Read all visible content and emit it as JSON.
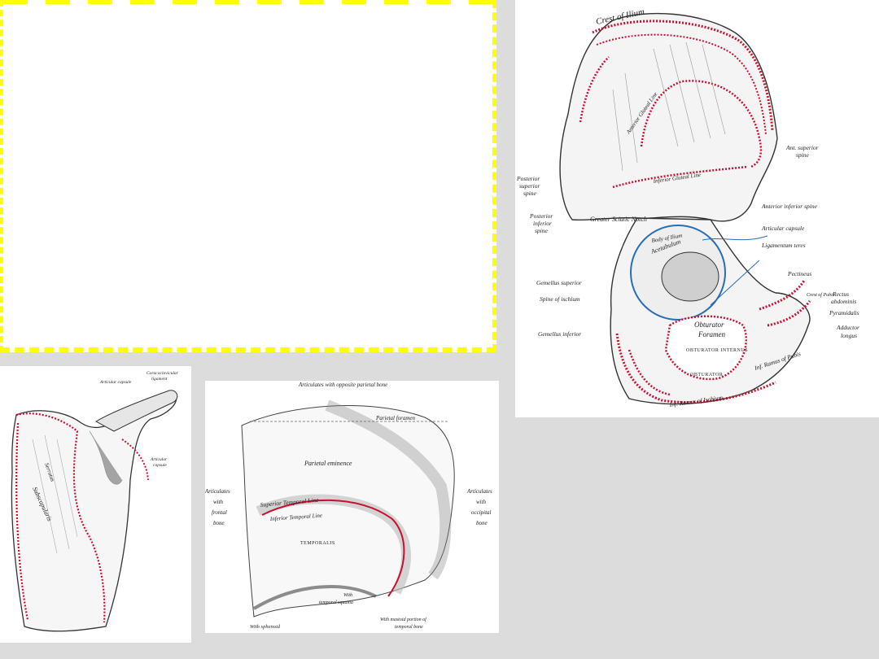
{
  "slide": {
    "placeholder_box": {
      "border_color": "#ffff00",
      "style": "dashed"
    }
  },
  "colors": {
    "background": "#dcdcdc",
    "muscle_attachment_red": "#c8102e",
    "ligament_blue": "#2a6db5"
  },
  "pelvis": {
    "labels": {
      "crest": "Crest of Ilium",
      "ant_sup_spine": "Ant. superior",
      "ant_sup_spine_2": "spine",
      "post_sup_spine_1": "Posterior",
      "post_sup_spine_2": "superior",
      "post_sup_spine_3": "spine",
      "post_inf_spine_1": "Posterior",
      "post_inf_spine_2": "inferior",
      "post_inf_spine_3": "spine",
      "greater_sciatic": "Greater Sciatic Notch",
      "ant_inf_spine": "Anterior inferior spine",
      "articular_capsule": "Articular capsule",
      "lig_teres": "Ligamentum teres",
      "pectineus": "Pectineus",
      "rectus_1": "Rectus",
      "rectus_2": "abdominis",
      "pyramidalis": "Pyramidalis",
      "add_longus_1": "Adductor",
      "add_longus_2": "longus",
      "gemellus_sup": "Gemellus superior",
      "spine_ischium": "Spine of ischium",
      "gemellus_inf": "Gemellus inferior",
      "obturator": "Obturator",
      "foramen": "Foramen",
      "obturator_internus": "OBTURATOR INTERNUS",
      "obturator_ext": "OBTURATOR",
      "inf_ramus_pubis": "Inf. Ramus of Pubis",
      "inf_ramus_ischium": "Inf. Ramus of Ischium",
      "acetabulum": "Acetabulum",
      "body_ilium": "Body of Ilium",
      "inferior_gluteal_line": "Inferior Gluteal Line",
      "anterior_gluteal_line": "Anterior Gluteal Line",
      "crest_pubis": "Crest of Pubis"
    }
  },
  "scapula": {
    "labels": {
      "coracoclavicular_1": "Coracoclavicular",
      "coracoclavicular_2": "ligament",
      "articular_capsule": "Articular capsule",
      "articular_capsule_2a": "Articular",
      "articular_capsule_2b": "capsule",
      "serratus": "Serratus",
      "subscapularis": "Subscapularis"
    }
  },
  "parietal": {
    "labels": {
      "top": "Articulates with opposite parietal bone",
      "left_1": "Articulates",
      "left_2": "with",
      "left_3": "frontal",
      "left_4": "bone",
      "right_1": "Articulates",
      "right_2": "with",
      "right_3": "occipital",
      "right_4": "bone",
      "parietal_foramen": "Parietal foramen",
      "eminence": "Parietal eminence",
      "sup_temporal": "Superior Temporal Line",
      "inf_temporal": "Inferior Temporal Line",
      "temporalis": "TEMPORALIS",
      "squamous_1": "With",
      "squamous_2": "temporal squama",
      "sphenoid": "With sphenoid",
      "mastoid_1": "With mastoid portion of",
      "mastoid_2": "temporal bone"
    }
  }
}
